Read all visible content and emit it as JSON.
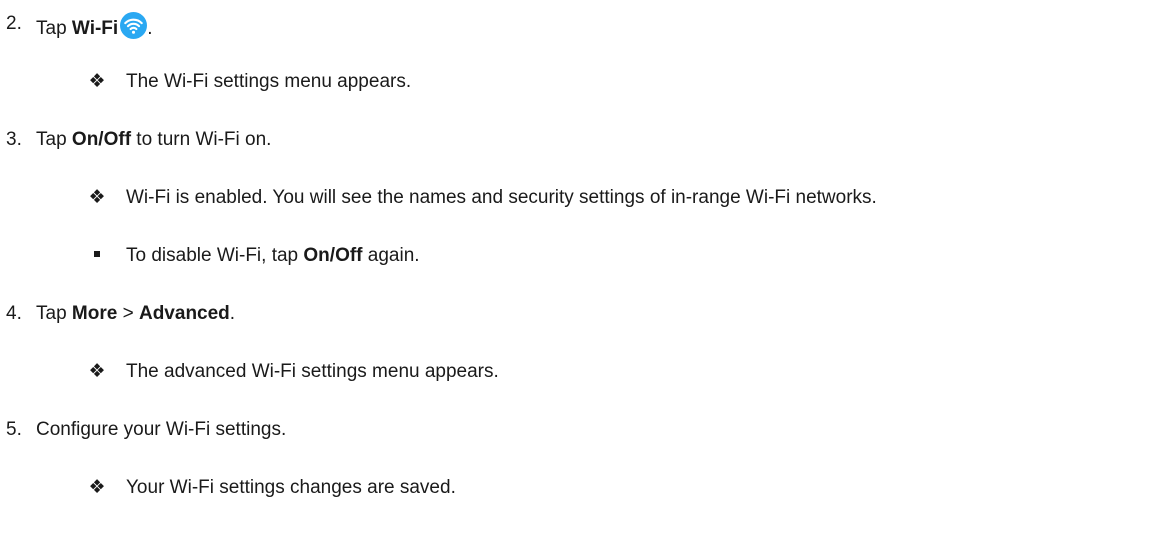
{
  "steps": [
    {
      "number": "2.",
      "segments": [
        "Tap ",
        "Wi-Fi",
        "",
        "."
      ],
      "icon": "wifi-icon",
      "notes": [
        {
          "bullet": "❖",
          "text": "The Wi-Fi settings menu appears."
        }
      ]
    },
    {
      "number": "3.",
      "segments": [
        "Tap ",
        "On/Off",
        " to turn Wi-Fi on."
      ],
      "notes": [
        {
          "bullet": "❖",
          "text": "Wi-Fi is enabled. You will see the names and security settings of in-range Wi-Fi networks."
        },
        {
          "bullet": "square",
          "segments": [
            "To disable Wi-Fi, tap ",
            "On/Off",
            " again."
          ]
        }
      ]
    },
    {
      "number": "4.",
      "segments": [
        "Tap ",
        "More",
        " > ",
        "Advanced",
        "."
      ],
      "notes": [
        {
          "bullet": "❖",
          "text": "The advanced Wi-Fi settings menu appears."
        }
      ]
    },
    {
      "number": "5.",
      "segments": [
        "Configure your Wi-Fi settings."
      ],
      "notes": [
        {
          "bullet": "❖",
          "text": "Your Wi-Fi settings changes are saved."
        }
      ]
    }
  ],
  "colors": {
    "text": "#1a1a1a",
    "wifi_icon_bg": "#2aa8f2",
    "wifi_icon_fg": "#ffffff"
  }
}
